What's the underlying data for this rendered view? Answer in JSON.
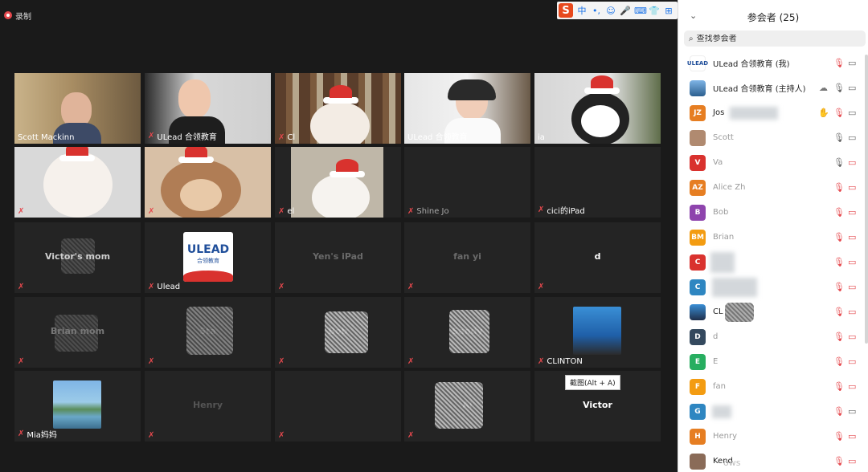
{
  "recording": {
    "label": "录制"
  },
  "ime": {
    "logo": "S",
    "items": [
      "中",
      "•,",
      "☺",
      "🎤",
      "⌨",
      "👕",
      "⊞"
    ]
  },
  "tiles": [
    {
      "name": "Scott Mackinn"
    },
    {
      "name": "ULead 合领教育"
    },
    {
      "name": "Cl"
    },
    {
      "name": "ULead 合领教育"
    },
    {
      "name": "ia"
    },
    {
      "name": ""
    },
    {
      "name": ""
    },
    {
      "name": "el"
    },
    {
      "name": "Shine Jo"
    },
    {
      "name": "cici的iPad"
    },
    {
      "name": "",
      "center": "Victor's mom"
    },
    {
      "name": "Ulead",
      "logo_text": "ULEAD",
      "logo_sub": "合领教育"
    },
    {
      "name": "",
      "center": "Yen's iPad"
    },
    {
      "name": "",
      "center": "fan yi"
    },
    {
      "name": "",
      "center": "d"
    },
    {
      "name": "",
      "center": "Brian mom"
    },
    {
      "name": "",
      "center": "Sta"
    },
    {
      "name": "",
      "center": "Bob"
    },
    {
      "name": "",
      "center": "Sandy"
    },
    {
      "name": "CLINTON"
    },
    {
      "name": "Mia妈妈"
    },
    {
      "name": "",
      "center": "Henry"
    },
    {
      "name": "",
      "center": ""
    },
    {
      "name": "",
      "center": "Al"
    },
    {
      "name": "",
      "center": "Victor"
    }
  ],
  "tooltip": "截图(Alt + A)",
  "panel": {
    "title": "参会者 (25)",
    "search_placeholder": "查找参会者",
    "participants": [
      {
        "name": "ULead 合领教育 (我)",
        "initials": "",
        "color": "#ffffff"
      },
      {
        "name": "ULead 合领教育 (主持人)",
        "initials": "",
        "color": "#3a78b5"
      },
      {
        "name": "Jos",
        "initials": "JZ",
        "color": "#e67e22"
      },
      {
        "name": "Scott",
        "initials": "",
        "color": "#888888"
      },
      {
        "name": "Va",
        "initials": "V",
        "color": "#d9322e"
      },
      {
        "name": "Alice Zh",
        "initials": "AZ",
        "color": "#e67e22"
      },
      {
        "name": "Bob",
        "initials": "B",
        "color": "#8e44ad"
      },
      {
        "name": "Brian",
        "initials": "BM",
        "color": "#f39c12"
      },
      {
        "name": "",
        "initials": "C",
        "color": "#d9322e"
      },
      {
        "name": "",
        "initials": "C",
        "color": "#2e86c1"
      },
      {
        "name": "CL",
        "initials": "",
        "color": "#4a6fa5"
      },
      {
        "name": "d",
        "initials": "D",
        "color": "#34495e"
      },
      {
        "name": "E",
        "initials": "E",
        "color": "#27ae60"
      },
      {
        "name": "fan",
        "initials": "F",
        "color": "#f39c12"
      },
      {
        "name": "",
        "initials": "G",
        "color": "#2e86c1"
      },
      {
        "name": "Henry",
        "initials": "H",
        "color": "#e67e22"
      },
      {
        "name": "Kend",
        "initials": "",
        "color": "#888888"
      }
    ]
  },
  "watermark": "ows"
}
